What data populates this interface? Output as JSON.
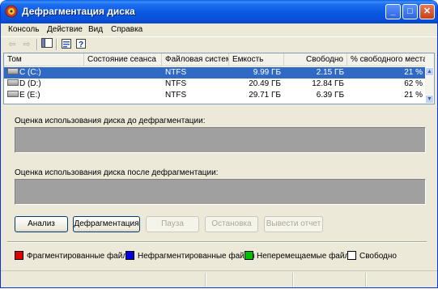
{
  "window": {
    "title": "Дефрагментация диска"
  },
  "menu": [
    "Консоль",
    "Действие",
    "Вид",
    "Справка"
  ],
  "toolbar": {
    "back_icon": "arrow-left-icon",
    "forward_icon": "arrow-right-icon",
    "properties_icon": "properties-icon",
    "help_icon": "help-icon",
    "console_icon": "console-tree-icon"
  },
  "volumes": {
    "columns": [
      "Том",
      "Состояние сеанса",
      "Файловая система",
      "Емкость",
      "Свободно",
      "% свободного места"
    ],
    "rows": [
      {
        "volume": "C (C:)",
        "status": "",
        "fs": "NTFS",
        "capacity": "9.99 ГБ",
        "free": "2.15 ГБ",
        "free_pct": "21 %"
      },
      {
        "volume": "D (D:)",
        "status": "",
        "fs": "NTFS",
        "capacity": "20.49 ГБ",
        "free": "12.84 ГБ",
        "free_pct": "62 %"
      },
      {
        "volume": "E (E:)",
        "status": "",
        "fs": "NTFS",
        "capacity": "29.71 ГБ",
        "free": "6.39 ГБ",
        "free_pct": "21 %"
      }
    ]
  },
  "analysis": {
    "before_label": "Оценка использования диска до дефрагментации:",
    "after_label": "Оценка использования диска после дефрагментации:"
  },
  "buttons": {
    "analyze": "Анализ",
    "defragment": "Дефрагментация",
    "pause": "Пауза",
    "stop": "Остановка",
    "report": "Вывести отчет"
  },
  "legend": [
    {
      "label": "Фрагментированные файлы",
      "color": "#e00000"
    },
    {
      "label": "Нефрагментированные файлы",
      "color": "#0000e0"
    },
    {
      "label": "Неперемещаемые файлы",
      "color": "#00c000"
    },
    {
      "label": "Свободно",
      "color": "#ffffff"
    }
  ],
  "colors": {
    "selection": "#316ac5",
    "titlebar": "#0a58e0",
    "bar_gray": "#a0a0a0"
  }
}
